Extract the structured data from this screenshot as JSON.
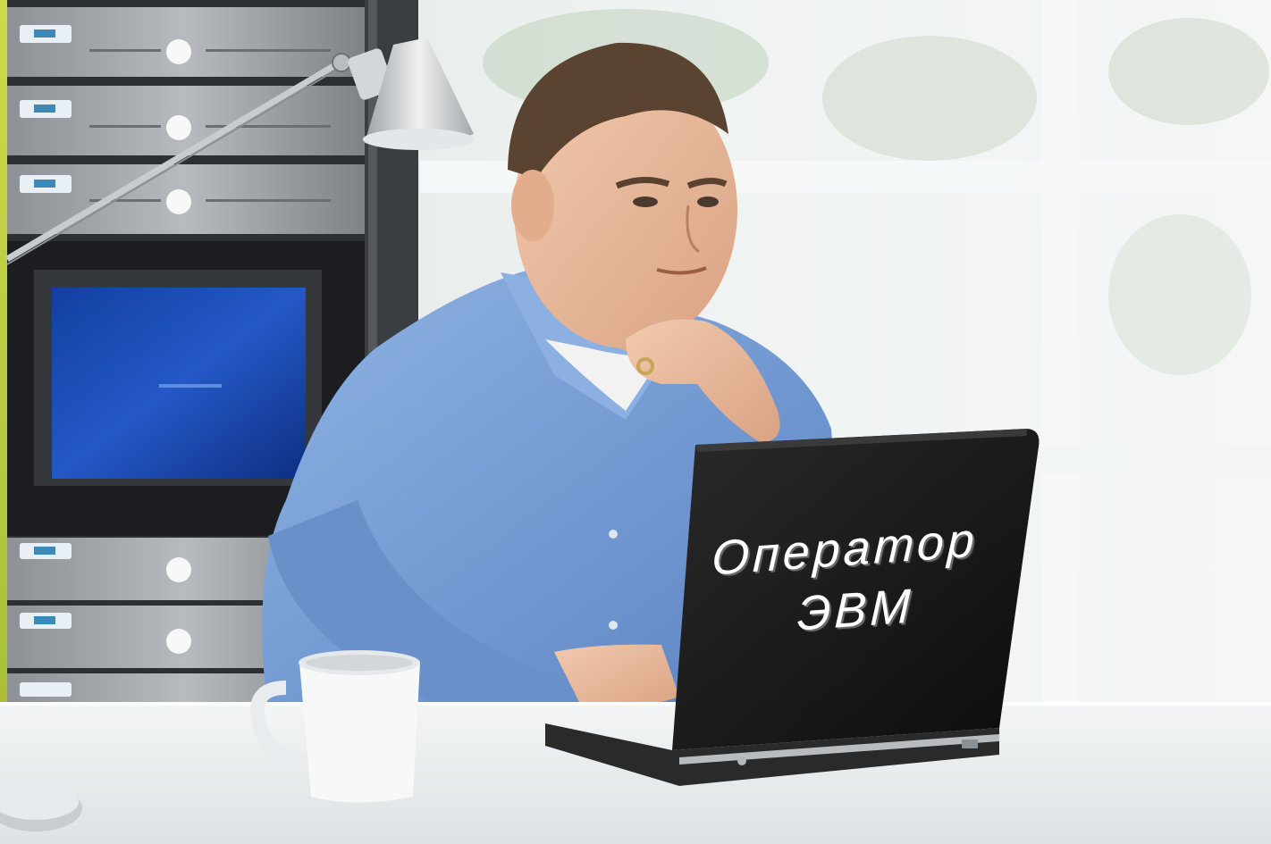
{
  "photo": {
    "laptop_lid_text": {
      "line1": "Оператор",
      "line2": "ЭВМ"
    }
  },
  "colors": {
    "shirt": "#7ea3d6",
    "laptop": "#1a1a1a",
    "server_rack": "#9a9ea3",
    "monitor_screen": "#1e4fb0",
    "desk": "#eef1f2",
    "window_light": "#e9eeee",
    "left_edge_accent": "#c9d23a"
  }
}
